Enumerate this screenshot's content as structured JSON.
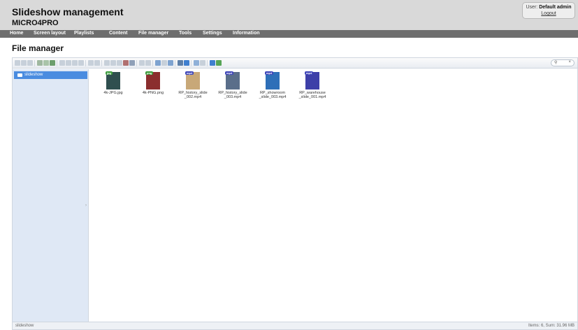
{
  "header": {
    "title": "Slideshow management",
    "subtitle": "MICRO4PRO",
    "user_prefix": "User:",
    "user_name": "Default admin",
    "logout": "Logout"
  },
  "nav": {
    "items": [
      "Home",
      "Screen layout",
      "Playlists",
      "Content",
      "File manager",
      "Tools",
      "Settings",
      "Information"
    ]
  },
  "page": {
    "title": "File manager"
  },
  "toolbar": {
    "icons": [
      "back-icon",
      "forward-icon",
      "up-icon",
      "home-icon",
      "reload-icon",
      "save-icon",
      "open-icon",
      "new-file-icon",
      "download-icon",
      "upload-icon",
      "undo-icon",
      "redo-icon",
      "copy-icon",
      "cut-icon",
      "paste-icon",
      "delete-icon",
      "duplicate-icon",
      "rename-icon",
      "edit-icon",
      "resize-icon",
      "extract-icon",
      "archive-icon",
      "info-icon",
      "view-icon",
      "sort-icon",
      "list-view-icon",
      "icon-view-icon",
      "fullscreen-icon"
    ],
    "accent": "#4a8ce0"
  },
  "tree": {
    "root_label": "slideshow"
  },
  "files": [
    {
      "name": "4k-JPG.jpg",
      "type": "jpg",
      "tag_color": "#3b9c3b",
      "thumb": "#2f4f4f"
    },
    {
      "name": "4k-PNG.png",
      "type": "png",
      "tag_color": "#3b9c3b",
      "thumb": "#8b2e2e"
    },
    {
      "name": "RP_history_slide\n_002.mp4",
      "type": "mp4",
      "tag_color": "#3e45b8",
      "thumb": "#c8a878"
    },
    {
      "name": "RP_history_slide\n_003.mp4",
      "type": "mp4",
      "tag_color": "#3e45b8",
      "thumb": "#5a6e8a"
    },
    {
      "name": "RP_showroom\n_slide_003.mp4",
      "type": "mp4",
      "tag_color": "#3e45b8",
      "thumb": "#2e6fb8"
    },
    {
      "name": "RP_warehouse\n_slide_001.mp4",
      "type": "mp4",
      "tag_color": "#3e45b8",
      "thumb": "#3d3fa8"
    }
  ],
  "status": {
    "path": "slideshow",
    "summary": "Items: 6, Sum: 31.96 MB"
  }
}
